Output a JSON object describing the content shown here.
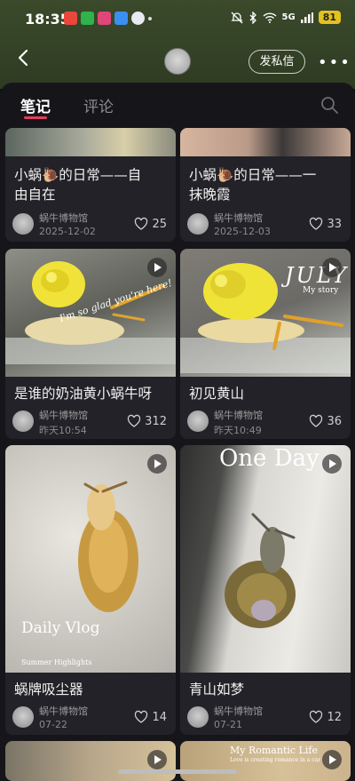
{
  "status": {
    "time": "18:35",
    "network": "5G",
    "battery": "81"
  },
  "header": {
    "dm_label": "发私信",
    "more_label": "•••"
  },
  "tabs": [
    {
      "label": "笔记",
      "active": true
    },
    {
      "label": "评论",
      "active": false
    }
  ],
  "cards": [
    {
      "title_line1": "小蜗🐌的日常——自",
      "title_line2": "由自在",
      "author": "蜗牛博物馆",
      "date": "2025-12-02",
      "likes": "25"
    },
    {
      "title_line1": "小蜗🐌的日常——一",
      "title_line2": "抹晚霞",
      "author": "蜗牛博物馆",
      "date": "2025-12-03",
      "likes": "33"
    },
    {
      "title_line1": "是谁的奶油黄小蜗牛呀",
      "title_line2": "",
      "author": "蜗牛博物馆",
      "date": "昨天10:54",
      "likes": "312",
      "overlay": "I'm so glad you're here!"
    },
    {
      "title_line1": "初见黄山",
      "title_line2": "",
      "author": "蜗牛博物馆",
      "date": "昨天10:49",
      "likes": "36",
      "overlay": "JULY",
      "overlay_sub": "My story"
    },
    {
      "title_line1": "蜗牌吸尘器",
      "title_line2": "",
      "author": "蜗牛博物馆",
      "date": "07-22",
      "likes": "14",
      "overlay": "Daily Vlog",
      "overlay_sub": "Summer Highlights"
    },
    {
      "title_line1": "青山如梦",
      "title_line2": "",
      "author": "蜗牛博物馆",
      "date": "07-21",
      "likes": "12",
      "overlay": "One Day"
    },
    {
      "overlay": "My Romantic Life",
      "overlay_sub": "Love is creating romance in a car"
    }
  ],
  "colors": {
    "accent": "#e63c5b",
    "background": "#16161a",
    "card": "#222228"
  }
}
